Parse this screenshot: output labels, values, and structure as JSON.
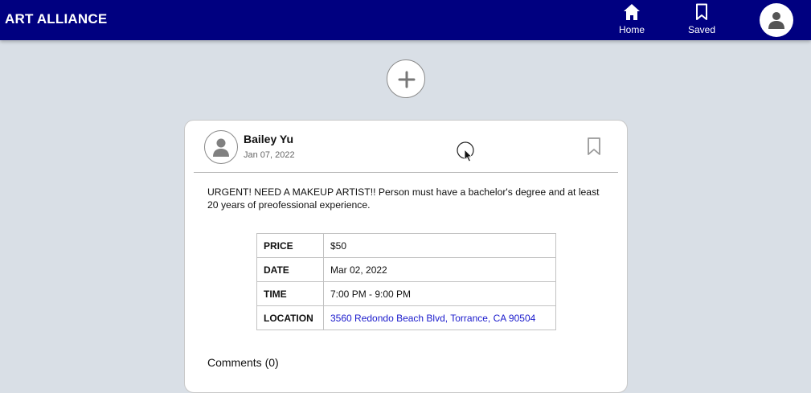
{
  "header": {
    "brand": "ART ALLIANCE",
    "nav": {
      "home_label": "Home",
      "saved_label": "Saved"
    },
    "colors": {
      "bar": "#000080",
      "text": "#ffffff"
    }
  },
  "post": {
    "author": "Bailey Yu",
    "date": "Jan 07, 2022",
    "text": "URGENT! NEED A MAKEUP ARTIST!! Person must have a bachelor's degree and at least 20 years of preofessional experience.",
    "details": {
      "price_label": "PRICE",
      "price_value": "$50",
      "date_label": "DATE",
      "date_value": "Mar 02, 2022",
      "time_label": "TIME",
      "time_value": "7:00 PM - 9:00 PM",
      "location_label": "LOCATION",
      "location_value": "3560 Redondo Beach Blvd, Torrance, CA 90504"
    },
    "comments_label": "Comments (0)"
  },
  "icons": {
    "home": "home-icon",
    "saved": "bookmark-icon",
    "profile": "user-icon",
    "add": "plus-icon",
    "post_bookmark": "bookmark-icon",
    "avatar": "user-icon",
    "cursor": "mouse-cursor"
  }
}
